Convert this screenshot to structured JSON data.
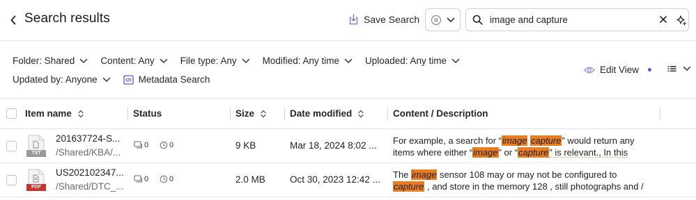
{
  "header": {
    "title": "Search results",
    "save_search_label": "Save Search",
    "search_value": "image and capture"
  },
  "filters": {
    "row1": [
      {
        "label": "Folder: Shared"
      },
      {
        "label": "Content: Any"
      },
      {
        "label": "File type: Any"
      },
      {
        "label": "Modified: Any time"
      },
      {
        "label": "Uploaded: Any time"
      }
    ],
    "updated_by": "Updated by: Anyone",
    "metadata_search": "Metadata Search",
    "edit_view": "Edit View"
  },
  "table": {
    "headers": {
      "item_name": "Item name",
      "status": "Status",
      "size": "Size",
      "date_modified": "Date modified",
      "content": "Content / Description"
    },
    "rows": [
      {
        "file_type": "TXT",
        "type_color": "#9a9a9a",
        "name": "201637724-S...",
        "path": "/Shared/KBA/...",
        "comments": "0",
        "versions": "0",
        "size": "9 KB",
        "date": "Mar 18, 2024 8:02 ...",
        "desc_l1": [
          {
            "t": "For example, a search for “"
          },
          {
            "t": "image",
            "hl": true
          },
          {
            "t": " "
          },
          {
            "t": "capture",
            "hl": true
          },
          {
            "t": "” would return any"
          }
        ],
        "desc_l2": [
          {
            "t": "items where either “"
          },
          {
            "t": "image",
            "hl": true
          },
          {
            "t": "” or “"
          },
          {
            "t": "capture",
            "hl": true
          },
          {
            "t": "” is relevant., In this"
          }
        ]
      },
      {
        "file_type": "PDF",
        "type_color": "#c8322a",
        "name": "US202102347...",
        "path": "/Shared/DTC_...",
        "comments": "0",
        "versions": "0",
        "size": "2.0 MB",
        "date": "Oct 30, 2023 12:42 ...",
        "desc_l1": [
          {
            "t": "The "
          },
          {
            "t": "image",
            "hl": true
          },
          {
            "t": " sensor 108 may or may not be configured to"
          }
        ],
        "desc_l2": [
          {
            "t": "capture",
            "hl": true
          },
          {
            "t": " , and store in the memory 128 , still photographs and /"
          }
        ]
      }
    ]
  },
  "colors": {
    "highlight": "#e87d22",
    "accent_purple": "#6553c9",
    "pdf_red": "#c8322a"
  }
}
